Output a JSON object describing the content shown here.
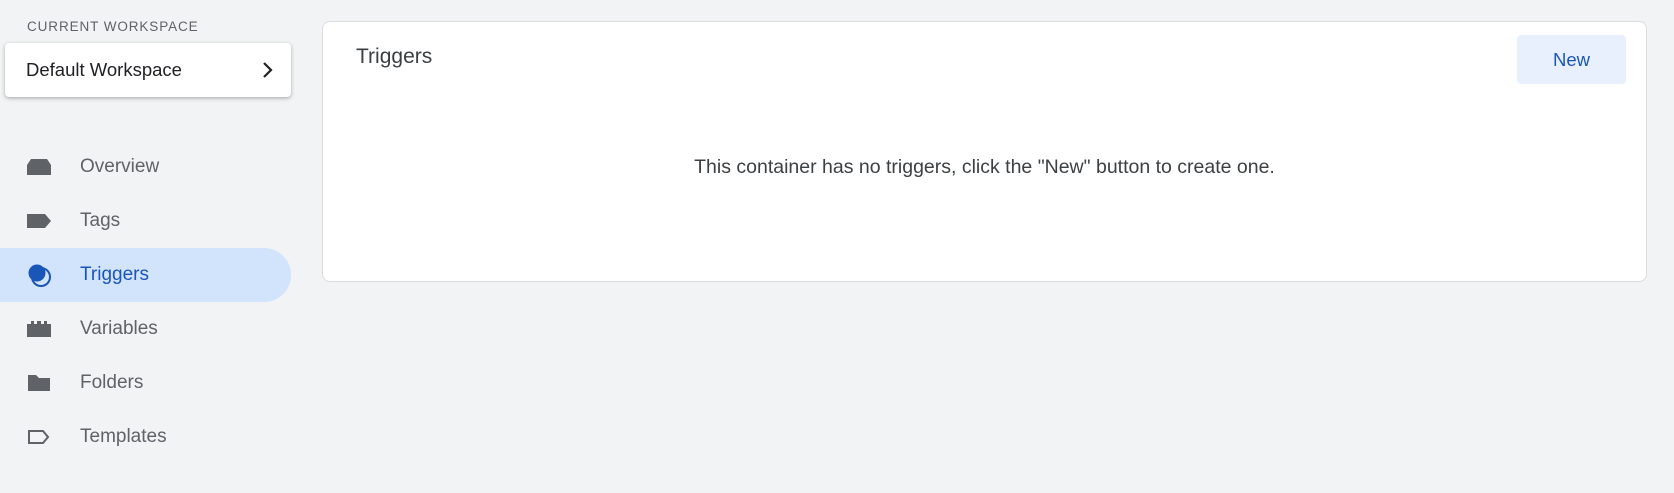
{
  "workspace": {
    "section_label": "CURRENT WORKSPACE",
    "name": "Default Workspace",
    "icon": "chevron-right-icon"
  },
  "nav": {
    "items": [
      {
        "label": "Overview",
        "icon": "overview-icon",
        "active": false
      },
      {
        "label": "Tags",
        "icon": "tag-icon",
        "active": false
      },
      {
        "label": "Triggers",
        "icon": "triggers-icon",
        "active": true
      },
      {
        "label": "Variables",
        "icon": "variables-icon",
        "active": false
      },
      {
        "label": "Folders",
        "icon": "folder-icon",
        "active": false
      },
      {
        "label": "Templates",
        "icon": "template-icon",
        "active": false
      }
    ]
  },
  "main": {
    "title": "Triggers",
    "new_button_label": "New",
    "empty_message": "This container has no triggers, click the \"New\" button to create one."
  },
  "colors": {
    "background": "#f1f3f4",
    "active_nav_bg": "#d2e3fc",
    "accent_blue": "#1a56b8",
    "button_bg": "#e8f0fe",
    "icon_gray": "#5f6368"
  }
}
